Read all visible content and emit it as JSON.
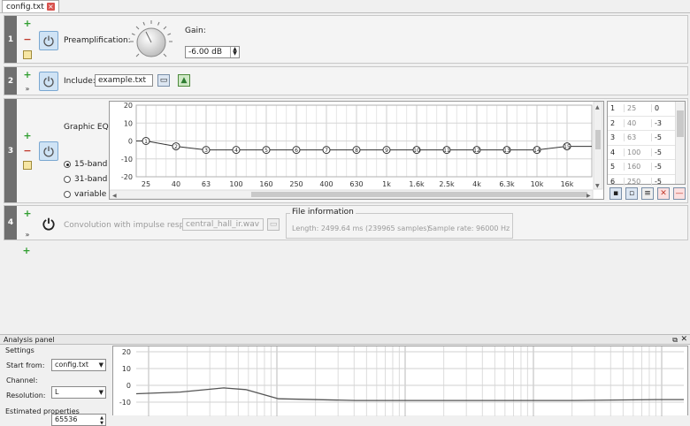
{
  "tabs": [
    {
      "label": "config.txt"
    }
  ],
  "rows": {
    "r1": {
      "number": "1",
      "label": "Preamplification:",
      "gain_label": "Gain:",
      "gain_value": "-6.00 dB"
    },
    "r2": {
      "number": "2",
      "label": "Include:",
      "include_value": "example.txt"
    },
    "r3": {
      "number": "3",
      "label": "Graphic EQ:",
      "modes": [
        {
          "label": "15-band",
          "checked": true
        },
        {
          "label": "31-band",
          "checked": false
        },
        {
          "label": "variable",
          "checked": false
        }
      ]
    },
    "r4": {
      "number": "4",
      "label": "Convolution with impulse response:",
      "file_value": "central_hall_ir.wav",
      "file_info_title": "File information",
      "length_text": "Length: 2499.64 ms (239965 samples)",
      "sample_rate_text": "Sample rate: 96000 Hz"
    }
  },
  "eq_table": [
    {
      "idx": "1",
      "freq": "25",
      "gain": "0"
    },
    {
      "idx": "2",
      "freq": "40",
      "gain": "-3"
    },
    {
      "idx": "3",
      "freq": "63",
      "gain": "-5"
    },
    {
      "idx": "4",
      "freq": "100",
      "gain": "-5"
    },
    {
      "idx": "5",
      "freq": "160",
      "gain": "-5"
    },
    {
      "idx": "6",
      "freq": "250",
      "gain": "-5"
    }
  ],
  "chart_data": [
    {
      "type": "line",
      "y_ticks": [
        "20",
        "10",
        "0",
        "-10",
        "-20"
      ],
      "ylim": [
        -20,
        20
      ],
      "categories": [
        "25",
        "40",
        "63",
        "100",
        "160",
        "250",
        "400",
        "630",
        "1k",
        "1.6k",
        "2.5k",
        "4k",
        "6.3k",
        "10k",
        "16k"
      ],
      "series": [
        {
          "points": [
            {
              "label": "1",
              "y": 0
            },
            {
              "label": "2",
              "y": -3
            },
            {
              "label": "3",
              "y": -5
            },
            {
              "label": "4",
              "y": -5
            },
            {
              "label": "5",
              "y": -5
            },
            {
              "label": "6",
              "y": -5
            },
            {
              "label": "7",
              "y": -5
            },
            {
              "label": "8",
              "y": -5
            },
            {
              "label": "9",
              "y": -5
            },
            {
              "label": "10",
              "y": -5
            },
            {
              "label": "11",
              "y": -5
            },
            {
              "label": "12",
              "y": -5
            },
            {
              "label": "13",
              "y": -5
            },
            {
              "label": "14",
              "y": -5
            },
            {
              "label": "15",
              "y": -3
            }
          ]
        }
      ],
      "grid": true
    },
    {
      "type": "line",
      "y_ticks": [
        "20",
        "10",
        "0",
        "-10"
      ],
      "ylim": [
        -15,
        20
      ],
      "x": [
        0,
        0.08,
        0.16,
        0.2,
        0.26,
        0.4,
        0.6,
        0.8,
        0.95,
        1.0
      ],
      "series": [
        {
          "values": [
            -5,
            -4,
            -1.5,
            -2.5,
            -8,
            -9,
            -9,
            -9,
            -8.5,
            -8.5
          ]
        }
      ],
      "grid": true
    }
  ],
  "analysis": {
    "title": "Analysis panel",
    "settings_label": "Settings",
    "start_from_label": "Start from:",
    "start_from_value": "config.txt",
    "channel_label": "Channel:",
    "channel_value": "L",
    "resolution_label": "Resolution:",
    "resolution_value": "65536",
    "estimated_label": "Estimated properties"
  },
  "colors": {
    "accent": "#cfe3f5",
    "rowbar": "#6f6f6f",
    "add": "#2f9e2f",
    "remove": "#c0392b"
  }
}
